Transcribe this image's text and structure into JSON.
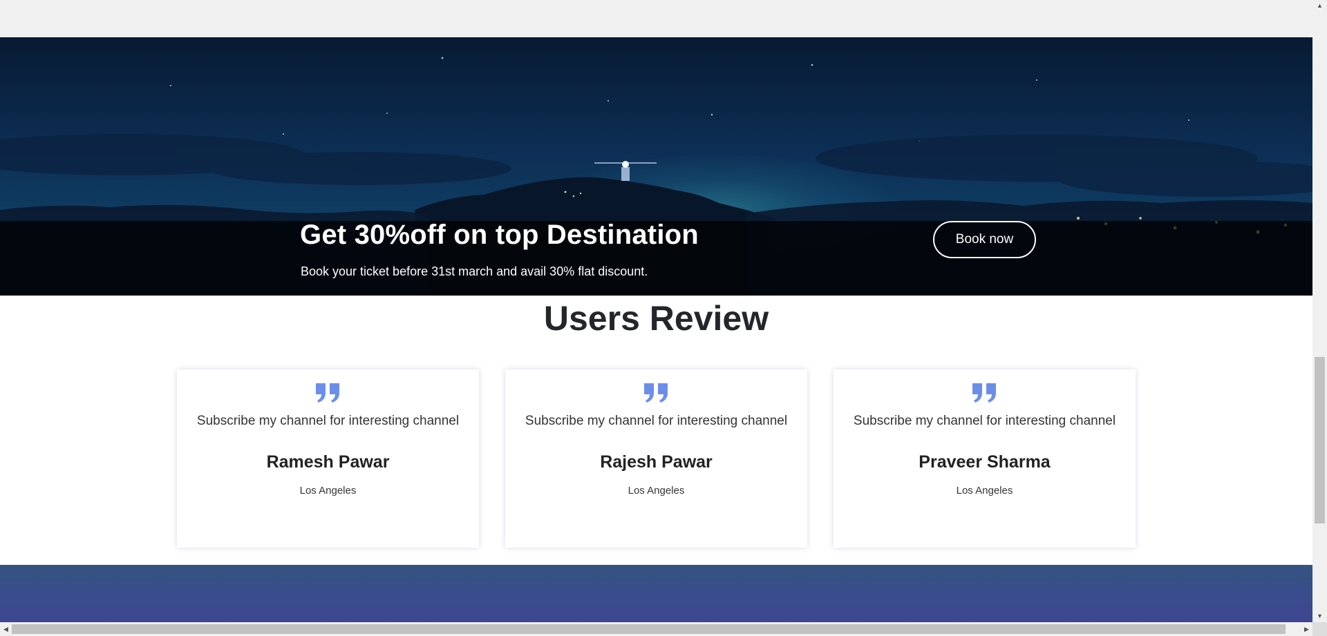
{
  "offer": {
    "title": "Get 30%off on top Destination",
    "subtitle": "Book your ticket before 31st march and avail 30% flat discount.",
    "button_label": "Book now"
  },
  "reviews": {
    "title": "Users Review",
    "items": [
      {
        "text": "Subscribe my channel for interesting channel",
        "name": "Ramesh Pawar",
        "city": "Los Angeles",
        "icon": "quote-icon"
      },
      {
        "text": "Subscribe my channel for interesting channel",
        "name": "Rajesh Pawar",
        "city": "Los Angeles",
        "icon": "quote-icon"
      },
      {
        "text": "Subscribe my channel for interesting channel",
        "name": "Praveer Sharma",
        "city": "Los Angeles",
        "icon": "quote-icon"
      }
    ]
  },
  "colors": {
    "quote_accent": "#6b8fe8",
    "offer_band": "#000000",
    "footer_start": "#33547f",
    "footer_end": "#3d468f"
  },
  "scrollbars": {
    "vertical_up_icon": "arrow-up-icon",
    "vertical_down_icon": "arrow-down-icon",
    "horizontal_left_icon": "arrow-left-icon",
    "horizontal_right_icon": "arrow-right-icon"
  }
}
